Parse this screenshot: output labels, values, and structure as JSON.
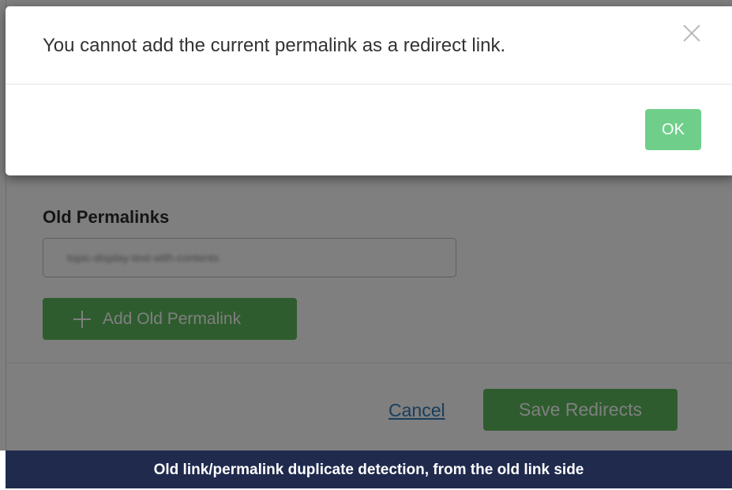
{
  "modal": {
    "message": "You cannot add the current permalink as a redirect link.",
    "close_icon": "close-icon",
    "ok_label": "OK"
  },
  "form": {
    "old_permalinks_label": "Old Permalinks",
    "old_permalink_value": "topic-display-text-with-contents",
    "add_button_label": "Add Old Permalink",
    "add_icon": "plus-icon",
    "cancel_label": "Cancel",
    "save_label": "Save Redirects"
  },
  "caption": {
    "text": "Old link/permalink duplicate detection, from the old link side"
  },
  "colors": {
    "primary_green": "#5cb85c",
    "ok_green": "#6fcf8a",
    "link_blue": "#337ab7",
    "caption_bg": "#1f2a4d"
  }
}
